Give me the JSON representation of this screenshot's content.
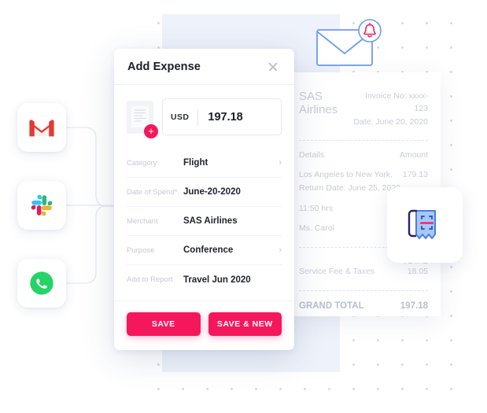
{
  "background": {
    "dot_grid": "dot-grid-pattern",
    "panel_color": "#eef2fa",
    "accent_color": "#f5175c",
    "bracket_color": "#f5175c"
  },
  "integrations": [
    {
      "name": "Gmail",
      "icon": "gmail-icon"
    },
    {
      "name": "Slack",
      "icon": "slack-icon"
    },
    {
      "name": "WhatsApp",
      "icon": "whatsapp-icon"
    }
  ],
  "envelope": {
    "icon": "envelope-icon",
    "badge_icon": "bell-notification-icon",
    "badge_color": "#f5175c",
    "stroke_color": "#5b8def"
  },
  "scan_tile": {
    "icon": "receipt-scan-icon"
  },
  "receipt": {
    "merchant": "SAS Airlines",
    "invoice_no": "Invoice No: xxxx-123",
    "date": "Date: June 20, 2020",
    "col_details": "Details",
    "col_amount": "Amount",
    "line_item": "Los Angeles to New York.",
    "line_return": "Return Date: June 25, 2020",
    "duration": "11:50 hrs",
    "passenger": "Ms. Carol",
    "subtotal_amount": "179.13",
    "total_label": "TOTAL",
    "fee_label": "Service Fee & Taxes",
    "fee_amount": "18.05",
    "grand_total_label": "GRAND TOTAL",
    "grand_total_amount": "197.18"
  },
  "card": {
    "title": "Add Expense",
    "close_icon": "close-icon",
    "thumbnail_icon": "document-thumbnail-icon",
    "add_attachment_icon": "plus-icon",
    "currency": "USD",
    "amount": "197.18",
    "fields": [
      {
        "label": "Category",
        "value": "Flight",
        "chevron": "›"
      },
      {
        "label": "Date of Spend*",
        "value": "June-20-2020",
        "chevron": ""
      },
      {
        "label": "Merchant",
        "value": "SAS Airlines",
        "chevron": ""
      },
      {
        "label": "Purpose",
        "value": "Conference",
        "chevron": "›"
      },
      {
        "label": "Add to Report",
        "value": "Travel Jun 2020",
        "chevron": ""
      }
    ],
    "save_label": "SAVE",
    "save_new_label": "SAVE & NEW"
  }
}
